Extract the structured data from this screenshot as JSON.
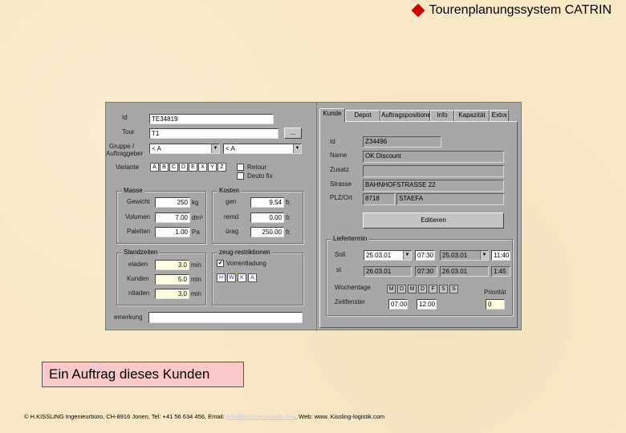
{
  "header": {
    "title": "Tourenplanungssystem CATRIN"
  },
  "colors": {
    "accent": "#d00000",
    "panel": "#a7a7a7",
    "highlight_field": "#ffffe0"
  },
  "left": {
    "id_label": "Id",
    "id_value": "TE34819",
    "tour_label": "Tour",
    "tour_value": "T1",
    "tour_button": "...",
    "gruppe_label_1": "Gruppe /",
    "gruppe_label_2": "Auftraggeber",
    "gruppe_value_1": "< A",
    "gruppe_value_2": "< A",
    "variante_label": "Variante",
    "variante_keys": [
      "A",
      "B",
      "C",
      "D",
      "E",
      "X",
      "Y",
      "Z"
    ],
    "retour_label": "Retour",
    "deutofix_label": "Deuto fix",
    "masse": {
      "title": "Masse",
      "rows": [
        {
          "label": "Gewicht",
          "value": "250",
          "unit": "kg"
        },
        {
          "label": "Volumen",
          "value": "7.00",
          "unit": "dm³"
        },
        {
          "label": "Paletten",
          "value": "1.00",
          "unit": "Pa"
        }
      ]
    },
    "kosten": {
      "title": "Kosten",
      "rows": [
        {
          "label": "gen",
          "value": "9.54",
          "unit": "fr."
        },
        {
          "label": "remd",
          "value": "0.00",
          "unit": "fr."
        },
        {
          "label": "ürag",
          "value": "250.00",
          "unit": "fr."
        }
      ]
    },
    "standzeiten": {
      "title": "Standzeiten",
      "rows": [
        {
          "label": "eladen",
          "value": "3.0",
          "unit": "min"
        },
        {
          "label": "Kunden",
          "value": "5.0",
          "unit": "min"
        },
        {
          "label": "ntladen",
          "value": "3.0",
          "unit": "min"
        }
      ]
    },
    "restriktionen": {
      "title": "zeug-restriktionen",
      "checkbox_label": "Vorrentladung",
      "keys": [
        "H",
        "W",
        "K",
        "A"
      ]
    },
    "bemerkung_label": "emerkung"
  },
  "tabs": [
    "Kunde",
    "Depot",
    "Auftragspositionen",
    "Info",
    "Kapazität",
    "Extra"
  ],
  "right": {
    "id_label": "Id",
    "id_value": "Z34496",
    "name_label": "Name",
    "name_value": "OK Discount",
    "zusatz_label": "Zusatz",
    "zusatz_value": "",
    "strasse_label": "Strasse",
    "strasse_value": "BAHNHOFSTRASSE 22",
    "plz_label": "PLZ/Ort",
    "plz_value": "8718",
    "ort_value": "STAEFA",
    "edit_button": "Editieren",
    "liefertermin": {
      "title": "Liefertermin",
      "soll_label": "Soll",
      "soll_date": "25.03.01",
      "soll_time": "07:30",
      "soll_date2": "25.03.01",
      "soll_time2": "11:40",
      "ist_label": "st",
      "ist_date": "26.03.01",
      "ist_time": "07:30",
      "ist_date2": "26.03.01",
      "ist_time2": "1:45",
      "wochentage_label": "Wochentage",
      "weekdays": [
        "M",
        "D",
        "M",
        "D",
        "F",
        "S",
        "S"
      ],
      "prioritaet_label": "Priorität",
      "prioritaet_value": "0",
      "zeitfenster_label": "Zeitfenster",
      "zeit_von": "07.00",
      "zeit_bis": "12.00"
    }
  },
  "caption": "Ein Auftrag dieses Kunden",
  "footer": {
    "text_before": "© H.KISSLING Ingenieurbüro, CH-8916 Jonen, Tel: +41 56 634 456, Email: ",
    "email": "info@kissling-logistik.com",
    "text_after": ", Web: www. Kissling-logistik.com"
  }
}
